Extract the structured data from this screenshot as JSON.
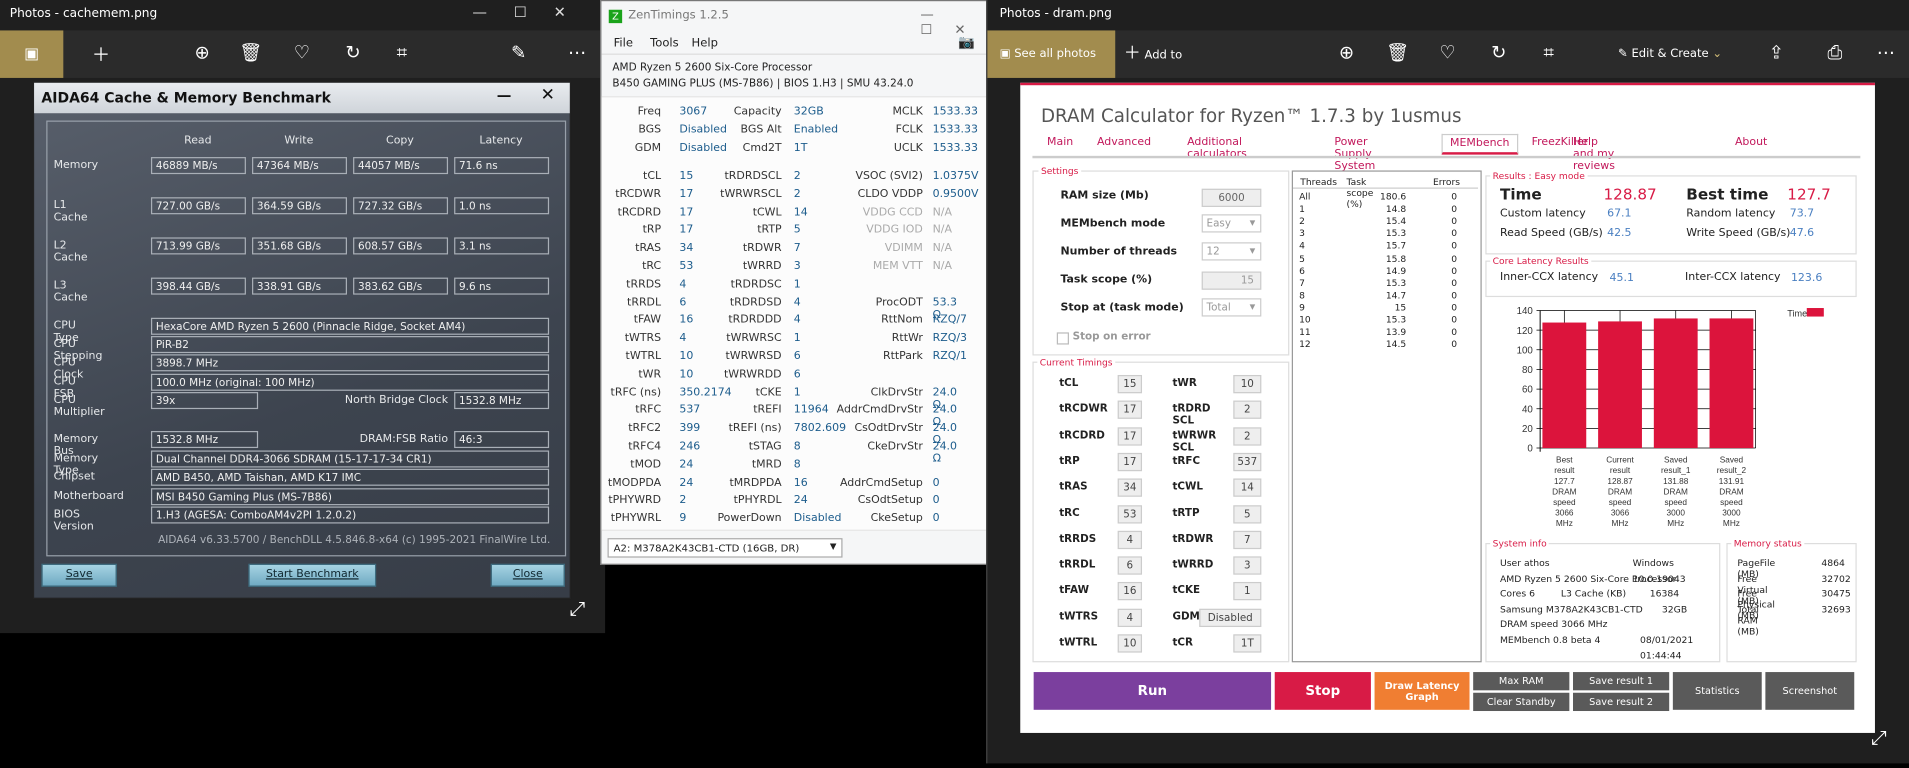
{
  "left_photos": {
    "title": "Photos - cachemem.png",
    "toolbar": [
      "image-icon",
      "add-icon",
      "zoom-icon",
      "delete-icon",
      "heart-icon",
      "rotate-icon",
      "crop-icon",
      "edit-icon",
      "more-icon"
    ]
  },
  "aida": {
    "title": "AIDA64 Cache & Memory Benchmark",
    "columns": [
      "Read",
      "Write",
      "Copy",
      "Latency"
    ],
    "rows": [
      {
        "label": "Memory",
        "values": [
          "46889 MB/s",
          "47364 MB/s",
          "44057 MB/s",
          "71.6 ns"
        ]
      },
      {
        "label": "L1 Cache",
        "values": [
          "727.00 GB/s",
          "364.59 GB/s",
          "727.32 GB/s",
          "1.0 ns"
        ]
      },
      {
        "label": "L2 Cache",
        "values": [
          "713.99 GB/s",
          "351.68 GB/s",
          "608.57 GB/s",
          "3.1 ns"
        ]
      },
      {
        "label": "L3 Cache",
        "values": [
          "398.44 GB/s",
          "338.91 GB/s",
          "383.62 GB/s",
          "9.6 ns"
        ]
      }
    ],
    "info": {
      "cpu_type": {
        "label": "CPU Type",
        "value": "HexaCore AMD Ryzen 5 2600  (Pinnacle Ridge, Socket AM4)"
      },
      "cpu_stepping": {
        "label": "CPU Stepping",
        "value": "PiR-B2"
      },
      "cpu_clock": {
        "label": "CPU Clock",
        "value": "3898.7 MHz"
      },
      "cpu_fsb": {
        "label": "CPU FSB",
        "value": "100.0 MHz  (original: 100 MHz)"
      },
      "cpu_multiplier": {
        "label": "CPU Multiplier",
        "value": "39x"
      },
      "nb_clock": {
        "label": "North Bridge Clock",
        "value": "1532.8 MHz"
      },
      "memory_bus": {
        "label": "Memory Bus",
        "value": "1532.8 MHz"
      },
      "dram_fsb": {
        "label": "DRAM:FSB Ratio",
        "value": "46:3"
      },
      "memory_type": {
        "label": "Memory Type",
        "value": "Dual Channel DDR4-3066 SDRAM  (15-17-17-34 CR1)"
      },
      "chipset": {
        "label": "Chipset",
        "value": "AMD B450, AMD Taishan, AMD K17 IMC"
      },
      "motherboard": {
        "label": "Motherboard",
        "value": "MSI B450 Gaming Plus (MS-7B86)"
      },
      "bios": {
        "label": "BIOS Version",
        "value": "1.H3  (AGESA: ComboAM4v2PI 1.2.0.2)"
      }
    },
    "footer": "AIDA64 v6.33.5700 / BenchDLL 4.5.846.8-x64  (c) 1995-2021 FinalWire Ltd.",
    "buttons": {
      "save": "Save",
      "start": "Start Benchmark",
      "close": "Close"
    }
  },
  "zen": {
    "title": "ZenTimings 1.2.5",
    "menu": [
      "File",
      "Tools",
      "Help"
    ],
    "cpu": "AMD Ryzen 5 2600 Six-Core Processor",
    "board": "B450 GAMING PLUS (MS-7B86) | BIOS 1.H3 | SMU 43.24.0",
    "top": [
      [
        "Freq",
        "3067",
        "Capacity",
        "32GB",
        "MCLK",
        "1533.33"
      ],
      [
        "BGS",
        "Disabled",
        "BGS Alt",
        "Enabled",
        "FCLK",
        "1533.33"
      ],
      [
        "GDM",
        "Disabled",
        "Cmd2T",
        "1T",
        "UCLK",
        "1533.33"
      ]
    ],
    "rows": [
      [
        "tCL",
        "15",
        "tRDRDSCL",
        "2",
        "VSOC (SVI2)",
        "1.0375V"
      ],
      [
        "tRCDWR",
        "17",
        "tWRWRSCL",
        "2",
        "CLDO VDDP",
        "0.9500V"
      ],
      [
        "tRCDRD",
        "17",
        "tCWL",
        "14",
        "VDDG CCD",
        "N/A"
      ],
      [
        "tRP",
        "17",
        "tRTP",
        "5",
        "VDDG IOD",
        "N/A"
      ],
      [
        "tRAS",
        "34",
        "tRDWR",
        "7",
        "VDIMM",
        "N/A"
      ],
      [
        "tRC",
        "53",
        "tWRRD",
        "3",
        "MEM VTT",
        "N/A"
      ],
      [
        "tRRDS",
        "4",
        "tRDRDSC",
        "1",
        "",
        ""
      ],
      [
        "tRRDL",
        "6",
        "tRDRDSD",
        "4",
        "ProcODT",
        "53.3 Ω"
      ],
      [
        "tFAW",
        "16",
        "tRDRDDD",
        "4",
        "RttNom",
        "RZQ/7"
      ],
      [
        "tWTRS",
        "4",
        "tWRWRSC",
        "1",
        "RttWr",
        "RZQ/3"
      ],
      [
        "tWTRL",
        "10",
        "tWRWRSD",
        "6",
        "RttPark",
        "RZQ/1"
      ],
      [
        "tWR",
        "10",
        "tWRWRDD",
        "6",
        "",
        ""
      ],
      [
        "tRFC (ns)",
        "350.2174",
        "tCKE",
        "1",
        "ClkDrvStr",
        "24.0 Ω"
      ],
      [
        "tRFC",
        "537",
        "tREFI",
        "11964",
        "AddrCmdDrvStr",
        "24.0 Ω"
      ],
      [
        "tRFC2",
        "399",
        "tREFI (ns)",
        "7802.609",
        "CsOdtDrvStr",
        "24.0 Ω"
      ],
      [
        "tRFC4",
        "246",
        "tSTAG",
        "8",
        "CkeDrvStr",
        "24.0 Ω"
      ],
      [
        "tMOD",
        "24",
        "tMRD",
        "8",
        "",
        ""
      ],
      [
        "tMODPDA",
        "24",
        "tMRDPDA",
        "16",
        "AddrCmdSetup",
        "0"
      ],
      [
        "tPHYWRD",
        "2",
        "tPHYRDL",
        "24",
        "CsOdtSetup",
        "0"
      ],
      [
        "tPHYWRL",
        "9",
        "PowerDown",
        "Disabled",
        "CkeSetup",
        "0"
      ]
    ],
    "module_select": "A2: M378A2K43CB1-CTD (16GB, DR)"
  },
  "right_photos": {
    "title": "Photos - dram.png",
    "see_all": "See all photos",
    "add_to": "Add to",
    "edit_create": "Edit & Create"
  },
  "dram": {
    "title": "DRAM Calculator for Ryzen™ 1.7.3 by 1usmus",
    "tabs": [
      "Main",
      "Advanced",
      "Additional calculators",
      "Power Supply System",
      "MEMbench",
      "FreezKiller",
      "Help and my reviews",
      "About"
    ],
    "active_tab": "MEMbench",
    "settings": {
      "caption": "Settings",
      "ram_size_label": "RAM size (Mb)",
      "ram_size": "6000",
      "mode_label": "MEMbench mode",
      "mode": "Easy",
      "threads_label": "Number of threads",
      "threads": "12",
      "scope_label": "Task scope (%)",
      "scope": "15",
      "stop_label": "Stop at (task mode)",
      "stop": "Total",
      "stop_on_error": "Stop on error",
      "stop_on_error_checked": false
    },
    "timings": {
      "caption": "Current Timings",
      "rows": [
        [
          "tCL",
          "15",
          "tWR",
          "10"
        ],
        [
          "tRCDWR",
          "17",
          "tRDRD SCL",
          "2"
        ],
        [
          "tRCDRD",
          "17",
          "tWRWR SCL",
          "2"
        ],
        [
          "tRP",
          "17",
          "tRFC",
          "537"
        ],
        [
          "tRAS",
          "34",
          "tCWL",
          "14"
        ],
        [
          "tRC",
          "53",
          "tRTP",
          "5"
        ],
        [
          "tRRDS",
          "4",
          "tRDWR",
          "7"
        ],
        [
          "tRRDL",
          "6",
          "tWRRD",
          "3"
        ],
        [
          "tFAW",
          "16",
          "tCKE",
          "1"
        ],
        [
          "tWTRS",
          "4",
          "GDM",
          "Disabled"
        ],
        [
          "tWTRL",
          "10",
          "tCR",
          "1T"
        ]
      ]
    },
    "threads_table": {
      "headers": [
        "Threads",
        "Task scope (%)",
        "Errors"
      ],
      "rows": [
        [
          "All",
          "180.6",
          "0"
        ],
        [
          "1",
          "14.8",
          "0"
        ],
        [
          "2",
          "15.4",
          "0"
        ],
        [
          "3",
          "15.3",
          "0"
        ],
        [
          "4",
          "15.7",
          "0"
        ],
        [
          "5",
          "15.8",
          "0"
        ],
        [
          "6",
          "14.9",
          "0"
        ],
        [
          "7",
          "15.3",
          "0"
        ],
        [
          "8",
          "14.7",
          "0"
        ],
        [
          "9",
          "15",
          "0"
        ],
        [
          "10",
          "15.3",
          "0"
        ],
        [
          "11",
          "13.9",
          "0"
        ],
        [
          "12",
          "14.5",
          "0"
        ]
      ]
    },
    "results": {
      "caption": "Results : Easy mode",
      "time_label": "Time",
      "time": "128.87",
      "best_label": "Best time",
      "best": "127.7",
      "custom_label": "Custom latency",
      "custom": "67.1",
      "random_label": "Random latency",
      "random": "73.7",
      "read_label": "Read Speed (GB/s)",
      "read": "42.5",
      "write_label": "Write Speed (GB/s)",
      "write": "47.6"
    },
    "core_latency": {
      "caption": "Core Latency Results",
      "inner_label": "Inner-CCX latency",
      "inner": "45.1",
      "inter_label": "Inter-CCX latency",
      "inter": "123.6"
    },
    "system_info": {
      "caption": "System info",
      "user": "User athos",
      "os": "Windows 10.0.19043",
      "cpu": "AMD Ryzen 5 2600 Six-Core Processor",
      "cores": "Cores 6",
      "l3_label": "L3 Cache (KB)",
      "l3": "16384",
      "module": "Samsung M378A2K43CB1-CTD",
      "module_size": "32GB",
      "dram_speed": "DRAM speed 3066 MHz",
      "version": "MEMbench 0.8 beta 4",
      "datetime": "08/01/2021 01:44:44"
    },
    "memory_status": {
      "caption": "Memory status",
      "rows": [
        [
          "PageFile (MB)",
          "4864"
        ],
        [
          "Free Virtual (MB)",
          "32702"
        ],
        [
          "Free Physical (MB)",
          "30475"
        ],
        [
          "Total RAM (MB)",
          "32693"
        ]
      ]
    },
    "buttons": {
      "run": "Run",
      "stop": "Stop",
      "draw": "Draw Latency Graph",
      "max_ram": "Max RAM",
      "clear_standby": "Clear Standby",
      "save1": "Save result 1",
      "save2": "Save result 2",
      "statistics": "Statistics",
      "screenshot": "Screenshot"
    },
    "colors": {
      "accent": "#d81b46",
      "run": "#7b3f9e",
      "draw": "#f07e32",
      "gray_button": "#5a5a5a"
    }
  },
  "chart_data": {
    "type": "bar",
    "categories": [
      "Best result 127.7 DRAM speed 3066 MHz",
      "Current result 128.87 DRAM speed 3066 MHz",
      "Saved result_1 131.88 DRAM speed 3000 MHz",
      "Saved result_2 131.91 DRAM speed 3000 MHz"
    ],
    "category_lines": [
      [
        "Best",
        "result",
        "127.7",
        "DRAM",
        "speed",
        "3066",
        "MHz"
      ],
      [
        "Current",
        "result",
        "128.87",
        "DRAM",
        "speed",
        "3066",
        "MHz"
      ],
      [
        "Saved",
        "result_1",
        "131.88",
        "DRAM",
        "speed",
        "3000",
        "MHz"
      ],
      [
        "Saved",
        "result_2",
        "131.91",
        "DRAM",
        "speed",
        "3000",
        "MHz"
      ]
    ],
    "series": [
      {
        "name": "Time",
        "values": [
          127.7,
          128.87,
          131.88,
          131.91
        ],
        "color": "#dc143c"
      }
    ],
    "yticks": [
      0,
      20,
      40,
      60,
      80,
      100,
      120,
      140
    ],
    "ylim": [
      0,
      140
    ],
    "grid": true,
    "legend": "top-right"
  }
}
